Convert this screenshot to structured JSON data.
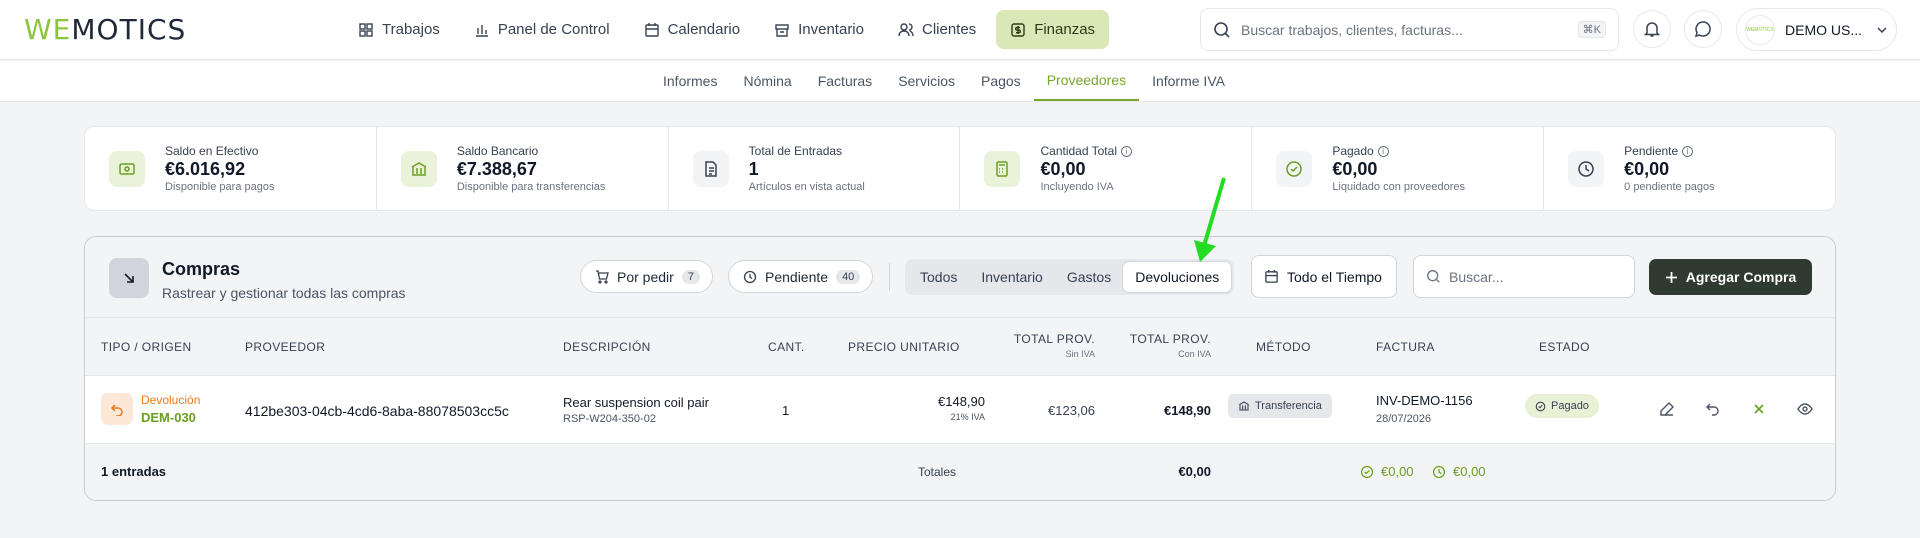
{
  "header": {
    "logo_we": "WE",
    "logo_rest": "MOTICS",
    "nav": [
      {
        "label": "Trabajos",
        "icon": "grid-icon"
      },
      {
        "label": "Panel de Control",
        "icon": "bar-chart-icon"
      },
      {
        "label": "Calendario",
        "icon": "calendar-icon"
      },
      {
        "label": "Inventario",
        "icon": "archive-icon"
      },
      {
        "label": "Clientes",
        "icon": "users-icon"
      },
      {
        "label": "Finanzas",
        "icon": "dollar-icon",
        "active": true
      }
    ],
    "search_placeholder": "Buscar trabajos, clientes, facturas...",
    "search_shortcut": "⌘K",
    "user_name": "DEMO US...",
    "avatar_text": "WEMOTICS"
  },
  "subnav": [
    "Informes",
    "Nómina",
    "Facturas",
    "Servicios",
    "Pagos",
    "Proveedores",
    "Informe IVA"
  ],
  "subnav_active": "Proveedores",
  "stats": [
    {
      "label": "Saldo en Efectivo",
      "value": "€6.016,92",
      "sub": "Disponible para pagos",
      "info": false
    },
    {
      "label": "Saldo Bancario",
      "value": "€7.388,67",
      "sub": "Disponible para transferencias",
      "info": false
    },
    {
      "label": "Total de Entradas",
      "value": "1",
      "sub": "Artículos en vista actual",
      "info": false
    },
    {
      "label": "Cantidad Total",
      "value": "€0,00",
      "sub": "Incluyendo IVA",
      "info": true
    },
    {
      "label": "Pagado",
      "value": "€0,00",
      "sub": "Liquidado con proveedores",
      "info": true
    },
    {
      "label": "Pendiente",
      "value": "€0,00",
      "sub": "0 pendiente pagos",
      "info": true
    }
  ],
  "panel": {
    "title": "Compras",
    "subtitle": "Rastrear y gestionar todas las compras",
    "por_pedir_label": "Por pedir",
    "por_pedir_count": "7",
    "pendiente_label": "Pendiente",
    "pendiente_count": "40",
    "filters": [
      "Todos",
      "Inventario",
      "Gastos",
      "Devoluciones"
    ],
    "filter_active": "Devoluciones",
    "time_label": "Todo el Tiempo",
    "search_placeholder": "Buscar...",
    "add_label": "Agregar Compra"
  },
  "table": {
    "headers": {
      "tipo": "TIPO / ORIGEN",
      "proveedor": "PROVEEDOR",
      "descripcion": "DESCRIPCIÓN",
      "cant": "CANT.",
      "precio": "PRECIO UNITARIO",
      "total_sin": "TOTAL PROV.",
      "total_sin_sub": "Sin IVA",
      "total_con": "TOTAL PROV.",
      "total_con_sub": "Con IVA",
      "metodo": "MÉTODO",
      "factura": "FACTURA",
      "estado": "ESTADO"
    },
    "row": {
      "tipo": "Devolución",
      "codigo": "DEM-030",
      "proveedor": "412be303-04cb-4cd6-8aba-88078503cc5c",
      "descripcion": "Rear suspension coil pair",
      "sku": "RSP-W204-350-02",
      "cant": "1",
      "precio": "€148,90",
      "iva": "21% IVA",
      "total_sin": "€123,06",
      "total_con": "€148,90",
      "metodo": "Transferencia",
      "factura": "INV-DEMO-1156",
      "fecha": "28/07/2026",
      "estado": "Pagado"
    },
    "footer": {
      "entries": "1 entradas",
      "totales_label": "Totales",
      "total": "€0,00",
      "paid": "€0,00",
      "pending": "€0,00"
    }
  },
  "colors": {
    "accent": "#7aa62e",
    "active_nav": "#d9e8b6",
    "add_button": "#2f3a30",
    "arrow": "#22dd22"
  }
}
